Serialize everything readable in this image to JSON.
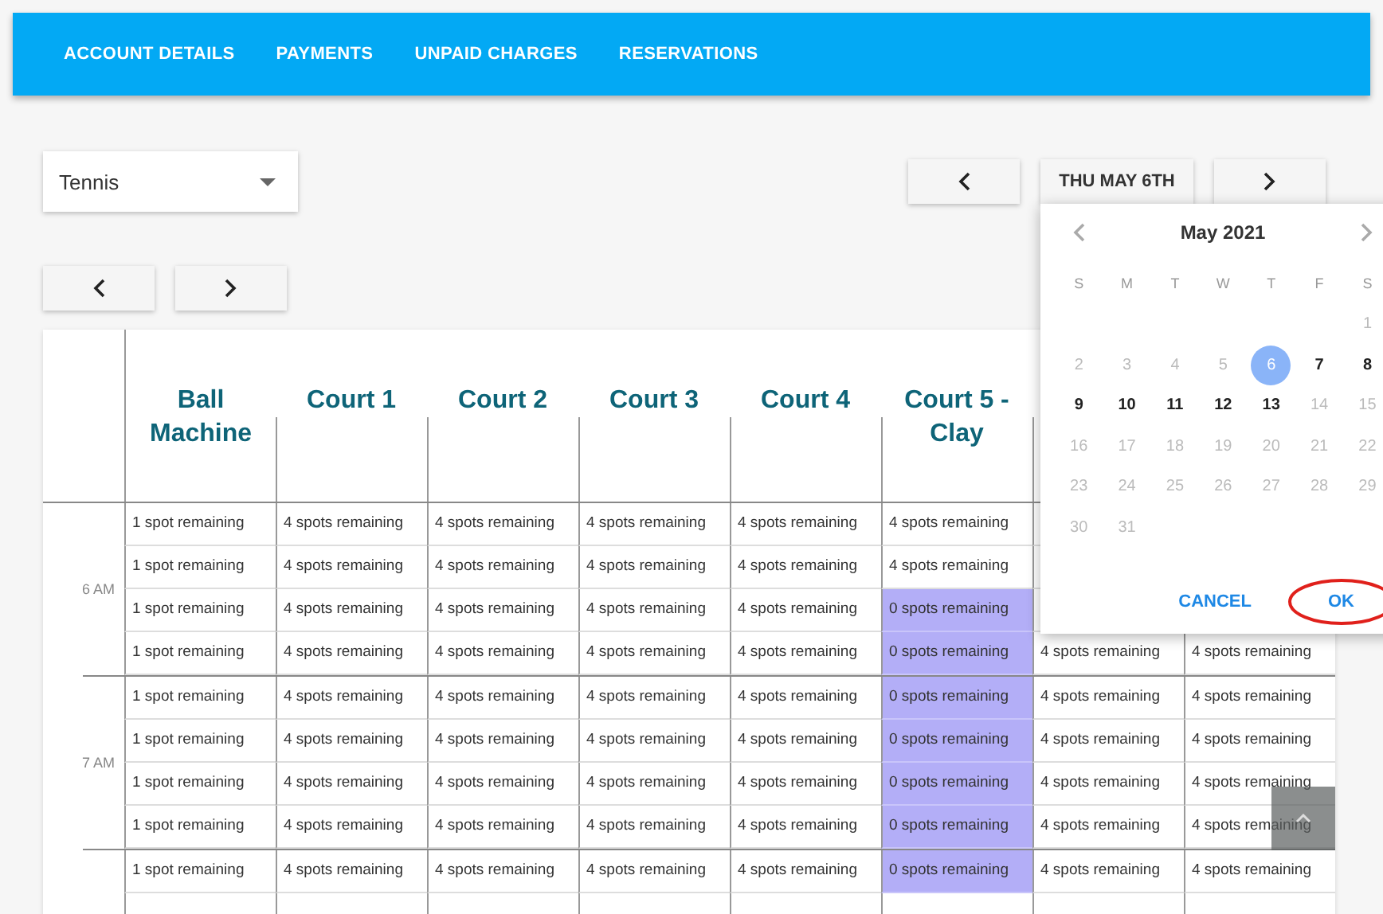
{
  "nav": {
    "tabs": [
      {
        "label": "ACCOUNT DETAILS"
      },
      {
        "label": "PAYMENTS"
      },
      {
        "label": "UNPAID CHARGES"
      },
      {
        "label": "RESERVATIONS"
      }
    ]
  },
  "sport_select": {
    "value": "Tennis"
  },
  "date_nav": {
    "date_label": "THU MAY 6TH"
  },
  "table": {
    "columns": [
      {
        "label": "Ball Machine"
      },
      {
        "label": "Court 1"
      },
      {
        "label": "Court 2"
      },
      {
        "label": "Court 3"
      },
      {
        "label": "Court 4"
      },
      {
        "label": "Court 5 - Clay"
      }
    ],
    "groups": [
      {
        "time": "6 AM",
        "rows": [
          {
            "cells": [
              {
                "text": "1 spot remaining",
                "full": false
              },
              {
                "text": "4 spots remaining",
                "full": false
              },
              {
                "text": "4 spots remaining",
                "full": false
              },
              {
                "text": "4 spots remaining",
                "full": false
              },
              {
                "text": "4 spots remaining",
                "full": false
              },
              {
                "text": "4 spots remaining",
                "full": false
              }
            ]
          },
          {
            "cells": [
              {
                "text": "1 spot remaining",
                "full": false
              },
              {
                "text": "4 spots remaining",
                "full": false
              },
              {
                "text": "4 spots remaining",
                "full": false
              },
              {
                "text": "4 spots remaining",
                "full": false
              },
              {
                "text": "4 spots remaining",
                "full": false
              },
              {
                "text": "4 spots remaining",
                "full": false
              }
            ]
          },
          {
            "cells": [
              {
                "text": "1 spot remaining",
                "full": false
              },
              {
                "text": "4 spots remaining",
                "full": false
              },
              {
                "text": "4 spots remaining",
                "full": false
              },
              {
                "text": "4 spots remaining",
                "full": false
              },
              {
                "text": "4 spots remaining",
                "full": false
              },
              {
                "text": "0 spots remaining",
                "full": true
              }
            ]
          },
          {
            "cells": [
              {
                "text": "1 spot remaining",
                "full": false
              },
              {
                "text": "4 spots remaining",
                "full": false
              },
              {
                "text": "4 spots remaining",
                "full": false
              },
              {
                "text": "4 spots remaining",
                "full": false
              },
              {
                "text": "4 spots remaining",
                "full": false
              },
              {
                "text": "0 spots remaining",
                "full": true
              },
              {
                "text": "4 spots remaining",
                "full": false
              },
              {
                "text": "4 spots remaining",
                "full": false
              }
            ]
          }
        ]
      },
      {
        "time": "7 AM",
        "rows": [
          {
            "cells": [
              {
                "text": "1 spot remaining",
                "full": false
              },
              {
                "text": "4 spots remaining",
                "full": false
              },
              {
                "text": "4 spots remaining",
                "full": false
              },
              {
                "text": "4 spots remaining",
                "full": false
              },
              {
                "text": "4 spots remaining",
                "full": false
              },
              {
                "text": "0 spots remaining",
                "full": true
              },
              {
                "text": "4 spots remaining",
                "full": false
              },
              {
                "text": "4 spots remaining",
                "full": false
              }
            ]
          },
          {
            "cells": [
              {
                "text": "1 spot remaining",
                "full": false
              },
              {
                "text": "4 spots remaining",
                "full": false
              },
              {
                "text": "4 spots remaining",
                "full": false
              },
              {
                "text": "4 spots remaining",
                "full": false
              },
              {
                "text": "4 spots remaining",
                "full": false
              },
              {
                "text": "0 spots remaining",
                "full": true
              },
              {
                "text": "4 spots remaining",
                "full": false
              },
              {
                "text": "4 spots remaining",
                "full": false
              }
            ]
          },
          {
            "cells": [
              {
                "text": "1 spot remaining",
                "full": false
              },
              {
                "text": "4 spots remaining",
                "full": false
              },
              {
                "text": "4 spots remaining",
                "full": false
              },
              {
                "text": "4 spots remaining",
                "full": false
              },
              {
                "text": "4 spots remaining",
                "full": false
              },
              {
                "text": "0 spots remaining",
                "full": true
              },
              {
                "text": "4 spots remaining",
                "full": false
              },
              {
                "text": "4 spots remaining",
                "full": false
              }
            ]
          },
          {
            "cells": [
              {
                "text": "1 spot remaining",
                "full": false
              },
              {
                "text": "4 spots remaining",
                "full": false
              },
              {
                "text": "4 spots remaining",
                "full": false
              },
              {
                "text": "4 spots remaining",
                "full": false
              },
              {
                "text": "4 spots remaining",
                "full": false
              },
              {
                "text": "0 spots remaining",
                "full": true
              },
              {
                "text": "4 spots remaining",
                "full": false
              },
              {
                "text": "4 spots remaining",
                "full": false
              }
            ]
          }
        ]
      },
      {
        "rows": [
          {
            "cells": [
              {
                "text": "1 spot remaining",
                "full": false
              },
              {
                "text": "4 spots remaining",
                "full": false
              },
              {
                "text": "4 spots remaining",
                "full": false
              },
              {
                "text": "4 spots remaining",
                "full": false
              },
              {
                "text": "4 spots remaining",
                "full": false
              },
              {
                "text": "0 spots remaining",
                "full": true
              },
              {
                "text": "4 spots remaining",
                "full": false
              },
              {
                "text": "4 spots remaining",
                "full": false
              }
            ]
          },
          {
            "cells": []
          }
        ]
      }
    ]
  },
  "calendar": {
    "month_label": "May 2021",
    "weekdays": [
      "S",
      "M",
      "T",
      "W",
      "T",
      "F",
      "S"
    ],
    "weeks": [
      {
        "days": [
          {
            "label": "1",
            "enabled": false,
            "selected": false
          }
        ]
      },
      {
        "days": [
          {
            "label": "2",
            "enabled": false,
            "selected": false
          },
          {
            "label": "3",
            "enabled": false,
            "selected": false
          },
          {
            "label": "4",
            "enabled": false,
            "selected": false
          },
          {
            "label": "5",
            "enabled": false,
            "selected": false
          },
          {
            "label": "6",
            "enabled": true,
            "selected": true
          },
          {
            "label": "7",
            "enabled": true,
            "selected": false
          },
          {
            "label": "8",
            "enabled": true,
            "selected": false
          }
        ]
      },
      {
        "days": [
          {
            "label": "9",
            "enabled": true,
            "selected": false
          },
          {
            "label": "10",
            "enabled": true,
            "selected": false
          },
          {
            "label": "11",
            "enabled": true,
            "selected": false
          },
          {
            "label": "12",
            "enabled": true,
            "selected": false
          },
          {
            "label": "13",
            "enabled": true,
            "selected": false
          },
          {
            "label": "14",
            "enabled": false,
            "selected": false
          },
          {
            "label": "15",
            "enabled": false,
            "selected": false
          }
        ]
      },
      {
        "days": [
          {
            "label": "16",
            "enabled": false,
            "selected": false
          },
          {
            "label": "17",
            "enabled": false,
            "selected": false
          },
          {
            "label": "18",
            "enabled": false,
            "selected": false
          },
          {
            "label": "19",
            "enabled": false,
            "selected": false
          },
          {
            "label": "20",
            "enabled": false,
            "selected": false
          },
          {
            "label": "21",
            "enabled": false,
            "selected": false
          },
          {
            "label": "22",
            "enabled": false,
            "selected": false
          }
        ]
      },
      {
        "days": [
          {
            "label": "23",
            "enabled": false,
            "selected": false
          },
          {
            "label": "24",
            "enabled": false,
            "selected": false
          },
          {
            "label": "25",
            "enabled": false,
            "selected": false
          },
          {
            "label": "26",
            "enabled": false,
            "selected": false
          },
          {
            "label": "27",
            "enabled": false,
            "selected": false
          },
          {
            "label": "28",
            "enabled": false,
            "selected": false
          },
          {
            "label": "29",
            "enabled": false,
            "selected": false
          }
        ]
      },
      {
        "days": [
          {
            "label": "30",
            "enabled": false,
            "selected": false
          },
          {
            "label": "31",
            "enabled": false,
            "selected": false
          }
        ]
      }
    ],
    "actions": [
      {
        "label": "CANCEL",
        "circled": false
      },
      {
        "label": "OK",
        "circled": true
      }
    ]
  }
}
